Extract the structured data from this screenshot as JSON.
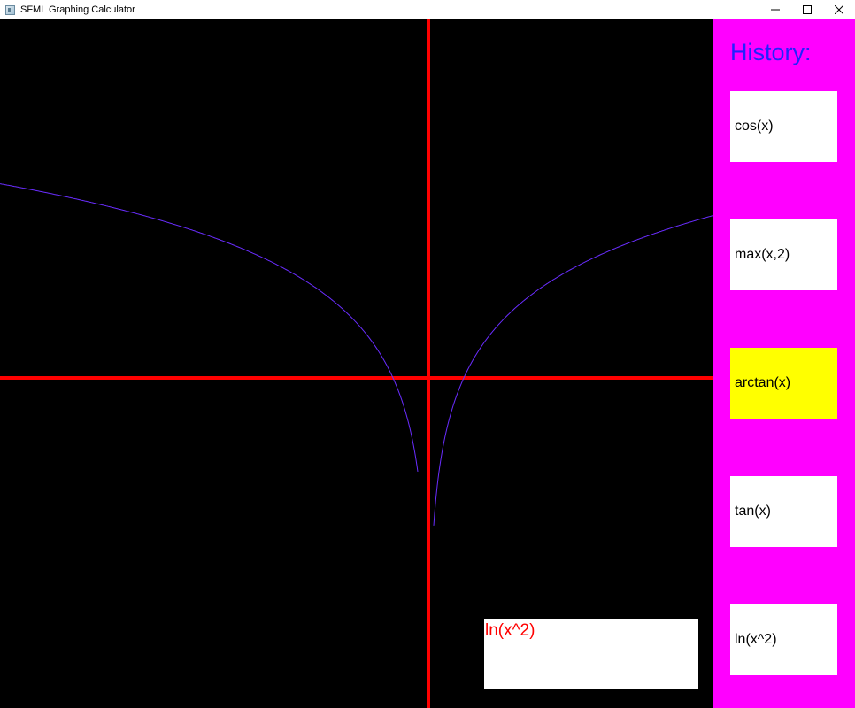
{
  "window": {
    "title": "SFML Graphing Calculator"
  },
  "colors": {
    "background": "#000000",
    "axes": "#ff0000",
    "curve": "#6a2dff",
    "sidebar": "#ff00ff",
    "history_title": "#2222ff",
    "history_item": "#ffffff",
    "history_item_selected": "#ffff00",
    "input_text": "#ff0000"
  },
  "graph": {
    "function": "ln(x^2)"
  },
  "input": {
    "value": "ln(x^2)"
  },
  "sidebar": {
    "title": "History:",
    "items": [
      {
        "label": "cos(x)",
        "selected": false
      },
      {
        "label": "max(x,2)",
        "selected": false
      },
      {
        "label": "arctan(x)",
        "selected": true
      },
      {
        "label": "tan(x)",
        "selected": false
      },
      {
        "label": "ln(x^2)",
        "selected": false
      }
    ]
  },
  "icons": {
    "minimize": "minimize-icon",
    "maximize": "maximize-icon",
    "close": "close-icon",
    "app": "app-icon"
  }
}
